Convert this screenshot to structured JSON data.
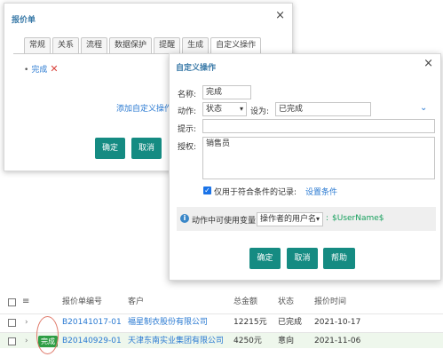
{
  "back_dialog": {
    "title": "报价单",
    "close": "×",
    "tabs": [
      "常规",
      "关系",
      "流程",
      "数据保护",
      "提醒",
      "生成",
      "自定义操作"
    ],
    "item_label": "完成",
    "delete_glyph": "✕",
    "add_link": "添加自定义操作",
    "confirm": "确定",
    "cancel": "取消"
  },
  "front_dialog": {
    "title": "自定义操作",
    "close": "×",
    "name_label": "名称:",
    "name_value": "完成",
    "action_label": "动作:",
    "action_value": "状态",
    "setto_label": "设为:",
    "setto_value": "已完成",
    "hint_label": "提示:",
    "hint_value": "",
    "auth_label": "授权:",
    "auth_value": "销售员",
    "condition_checkbox": "仅用于符合条件的记录:",
    "condition_link": "设置条件",
    "info_text": "动作中可使用变量",
    "var_select": "操作者的用户名",
    "var_colon": ":",
    "var_value": "$UserName$",
    "confirm": "确定",
    "cancel": "取消",
    "help": "帮助"
  },
  "table": {
    "headers": [
      "报价单编号",
      "客户",
      "总金额",
      "状态",
      "报价时间"
    ],
    "rows": [
      {
        "id": "B20141017-01",
        "customer": "福星制衣股份有限公司",
        "amount": "12215元",
        "status": "已完成",
        "date": "2021-10-17",
        "badge": ""
      },
      {
        "id": "B20140929-01",
        "customer": "天津东南实业集团有限公司",
        "amount": "4250元",
        "status": "意向",
        "date": "2021-11-06",
        "badge": "完成"
      }
    ]
  },
  "colors": {
    "accent": "#158b82",
    "link": "#2a7ad2",
    "title": "#3a7aa8",
    "badge": "#2e9e45"
  }
}
